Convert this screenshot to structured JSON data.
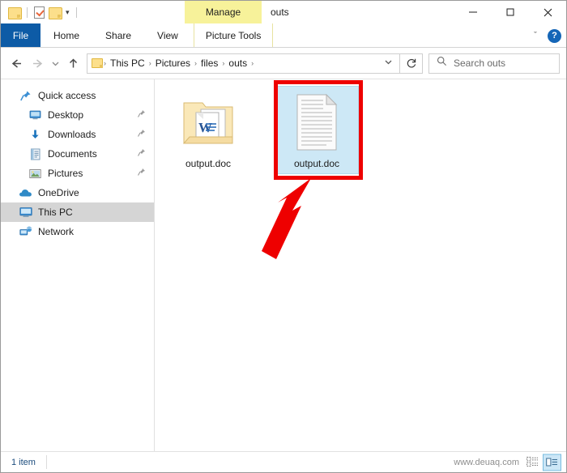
{
  "window": {
    "title": "outs",
    "contextual_tab_group": "Manage",
    "minimize_label": "Minimize",
    "maximize_label": "Maximize",
    "close_label": "Close"
  },
  "quick_access_toolbar": {
    "items": [
      {
        "name": "folder-icon",
        "label": "Explorer"
      },
      {
        "name": "properties-icon",
        "label": "Properties"
      },
      {
        "name": "new-folder-icon",
        "label": "New folder"
      },
      {
        "name": "customize-chevron",
        "label": "▾"
      }
    ]
  },
  "ribbon": {
    "file_tab": "File",
    "tabs": [
      "Home",
      "Share",
      "View"
    ],
    "contextual_tab": "Picture Tools",
    "collapse_label": "ˇ",
    "help_label": "?"
  },
  "navigation": {
    "back_label": "Back",
    "forward_label": "Forward",
    "recent_label": "Recent locations",
    "up_label": "Up",
    "refresh_label": "Refresh",
    "breadcrumbs": [
      "This PC",
      "Pictures",
      "files",
      "outs"
    ],
    "separator": "›"
  },
  "search": {
    "placeholder": "Search outs",
    "value": "",
    "icon": "search-icon"
  },
  "sidebar": {
    "items": [
      {
        "label": "Quick access",
        "icon": "pin-star-icon",
        "level": 0,
        "selected": false,
        "pinned": false
      },
      {
        "label": "Desktop",
        "icon": "desktop-icon",
        "level": 1,
        "selected": false,
        "pinned": true
      },
      {
        "label": "Downloads",
        "icon": "download-icon",
        "level": 1,
        "selected": false,
        "pinned": true
      },
      {
        "label": "Documents",
        "icon": "documents-icon",
        "level": 1,
        "selected": false,
        "pinned": true
      },
      {
        "label": "Pictures",
        "icon": "pictures-icon",
        "level": 1,
        "selected": false,
        "pinned": true
      },
      {
        "label": "OneDrive",
        "icon": "cloud-icon",
        "level": 0,
        "selected": false,
        "pinned": false
      },
      {
        "label": "This PC",
        "icon": "computer-icon",
        "level": 0,
        "selected": true,
        "pinned": false
      },
      {
        "label": "Network",
        "icon": "network-icon",
        "level": 0,
        "selected": false,
        "pinned": false
      }
    ]
  },
  "files": [
    {
      "name": "output.doc",
      "icon": "folder-with-word-doc-icon",
      "selected": false
    },
    {
      "name": "output.doc",
      "icon": "generic-document-icon",
      "selected": true
    }
  ],
  "annotation": {
    "highlight_color": "#ee0000",
    "arrow": "red-arrow-pointing-to-selected-file",
    "target": "output.doc"
  },
  "statusbar": {
    "item_count": "1 item",
    "watermark": "www.deuaq.com",
    "details_view_label": "Details view",
    "large_icons_view_label": "Large icons view"
  },
  "colors": {
    "file_tab_blue": "#0d5ba6",
    "contextual_yellow": "#f7f29a",
    "selection_blue": "#cde8f6",
    "nav_selection_gray": "#d5d5d5",
    "annotation_red": "#ee0000",
    "status_text_blue": "#1a4b7c"
  }
}
